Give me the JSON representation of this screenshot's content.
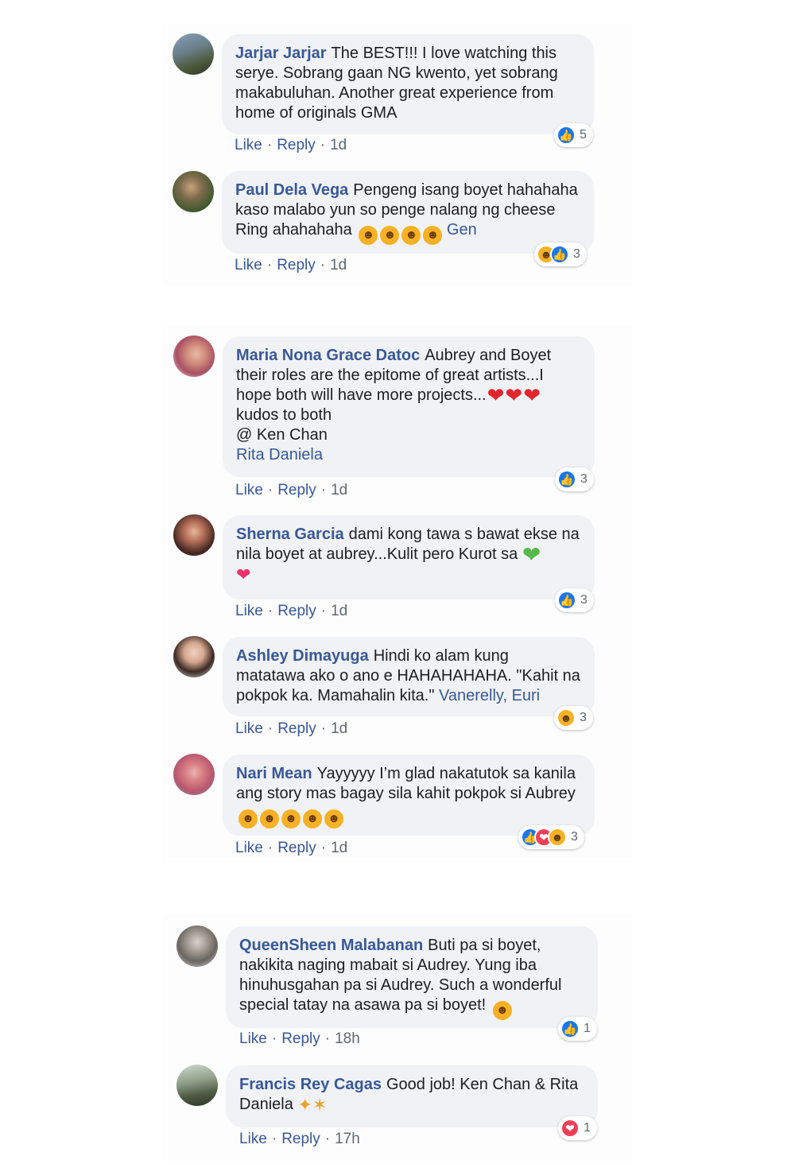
{
  "comments": [
    {
      "author": "Jarjar Jarjar",
      "text": "The BEST!!! I love watching this serye. Sobrang gaan NG kwento, yet sobrang makabuluhan. Another great experience from home of originals GMA",
      "like": "Like",
      "reply": "Reply",
      "time": "1d",
      "react_count": "5"
    },
    {
      "author": "Paul Dela Vega",
      "text": "Pengeng isang boyet hahahaha kaso malabo yun so penge nalang ng cheese Ring ahahahaha",
      "tag": "Gen",
      "like": "Like",
      "reply": "Reply",
      "time": "1d",
      "react_count": "3"
    },
    {
      "author": "Maria Nona Grace Datoc",
      "text": "Aubrey and Boyet their roles are the epitome of great artists...I hope both will have more projects...",
      "text2": "kudos to both",
      "text3": "@ Ken Chan",
      "tag": "Rita Daniela",
      "like": "Like",
      "reply": "Reply",
      "time": "1d",
      "react_count": "3"
    },
    {
      "author": "Sherna Garcia",
      "text": "dami kong tawa s bawat ekse na nila boyet at aubrey...Kulit pero Kurot sa",
      "like": "Like",
      "reply": "Reply",
      "time": "1d",
      "react_count": "3"
    },
    {
      "author": "Ashley Dimayuga",
      "text": "Hindi ko alam kung matatawa ako o ano e HAHAHAHAHA. \"Kahit na pokpok ka. Mamahalin kita.\"",
      "tag": "Vanerelly",
      "tag_sep": ",",
      "tag2": "Euri",
      "like": "Like",
      "reply": "Reply",
      "time": "1d",
      "react_count": "3"
    },
    {
      "author": "Nari Mean",
      "text": "Yayyyyy I’m glad nakatutok sa kanila ang story mas bagay sila kahit pokpok si Aubrey",
      "like": "Like",
      "reply": "Reply",
      "time": "1d",
      "react_count": "3"
    },
    {
      "author": "QueenSheen Malabanan",
      "text": "Buti pa si boyet, nakikita naging mabait si Audrey. Yung iba hinuhusgahan pa si Audrey. Such a wonderful special tatay na asawa pa si boyet!",
      "like": "Like",
      "reply": "Reply",
      "time": "18h",
      "react_count": "1"
    },
    {
      "author": "Francis Rey Cagas",
      "text": "Good job! Ken Chan & Rita Daniela",
      "like": "Like",
      "reply": "Reply",
      "time": "17h",
      "react_count": "1"
    }
  ],
  "colors": {
    "link": "#385898",
    "bubble": "#f0f2f5",
    "like": "#1877f2",
    "love": "#f33e58",
    "haha": "#f7b125"
  },
  "icons": {
    "like": "thumbs-up-icon",
    "love": "heart-icon",
    "haha": "laughing-face-icon",
    "wink": "winking-face-icon",
    "clap": "clapping-hands-icon"
  }
}
